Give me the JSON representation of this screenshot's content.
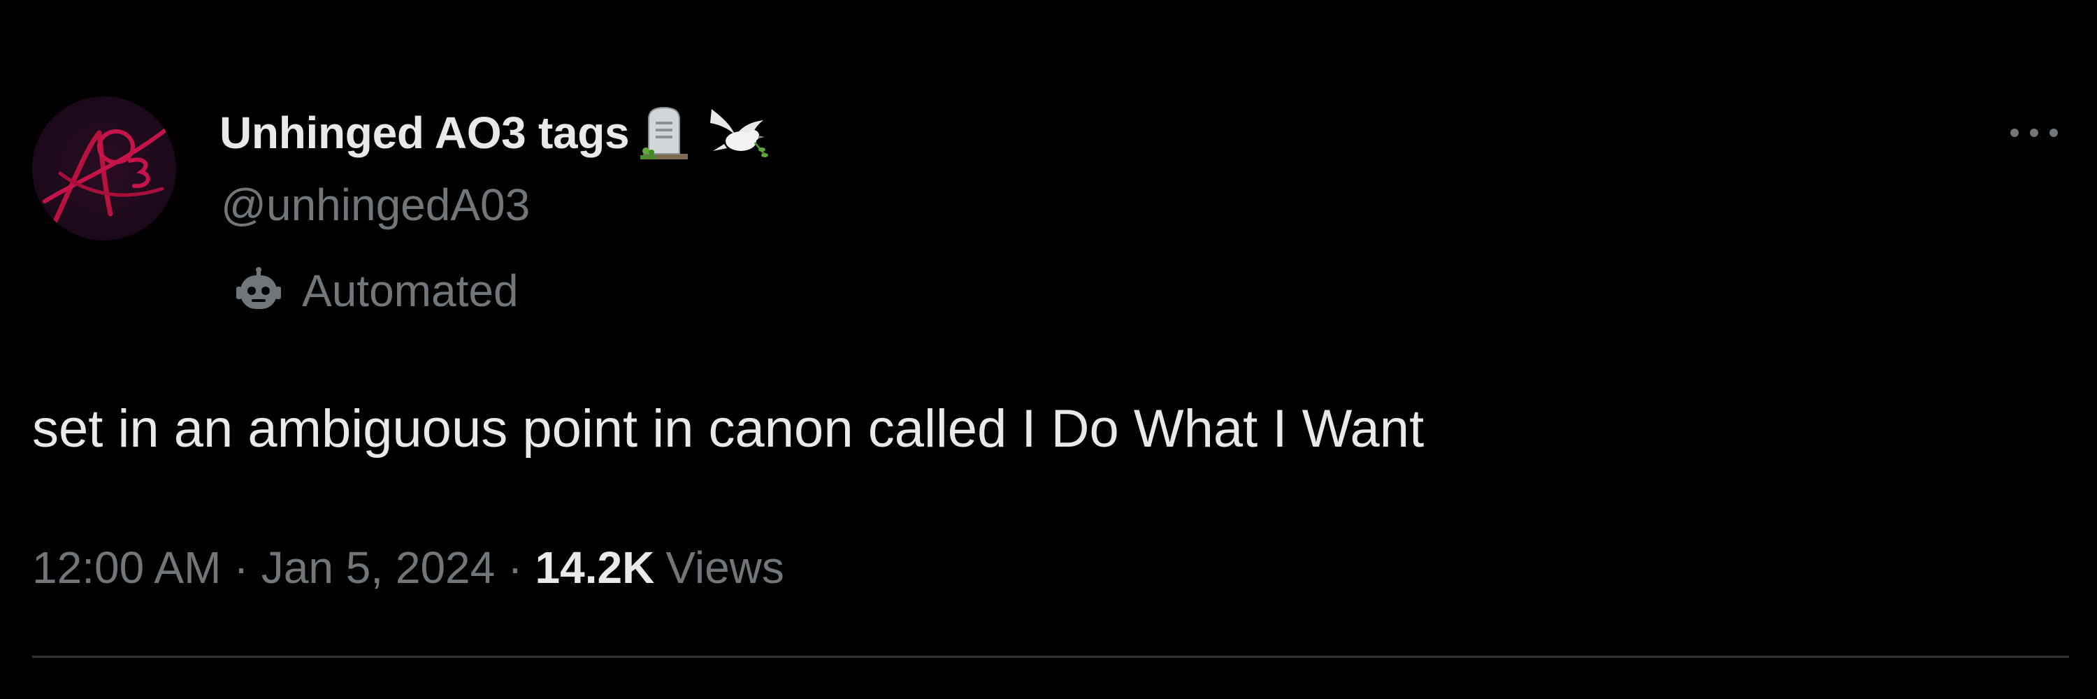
{
  "author": {
    "display_name": "Unhinged AO3 tags",
    "name_emojis": [
      "headstone-icon",
      "dove-icon"
    ],
    "handle": "@unhingedA03",
    "automated_label": "Automated",
    "avatar_icon": "ao3-logo-icon"
  },
  "tweet": {
    "text": "set in an ambiguous point in canon called I Do What I Want",
    "time": "12:00 AM",
    "separator": "·",
    "date": "Jan 5, 2024",
    "views_count": "14.2K",
    "views_label": "Views"
  },
  "actions": {
    "more_icon": "more-horizontal-icon"
  },
  "colors": {
    "background": "#000000",
    "primary_text": "#e7e9ea",
    "secondary_text": "#71767b",
    "divider": "#2f3336",
    "avatar_accent": "#c4144a"
  }
}
